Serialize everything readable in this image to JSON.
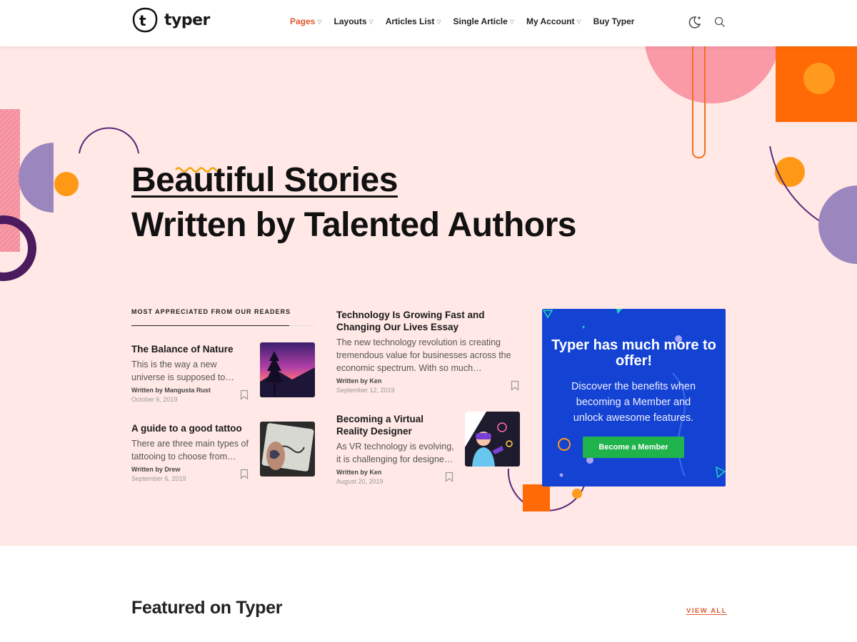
{
  "header": {
    "logo_text": "typer",
    "nav": [
      {
        "label": "Pages",
        "active": true,
        "chevron": true
      },
      {
        "label": "Layouts",
        "active": false,
        "chevron": true
      },
      {
        "label": "Articles List",
        "active": false,
        "chevron": true
      },
      {
        "label": "Single Article",
        "active": false,
        "chevron": true
      },
      {
        "label": "My Account",
        "active": false,
        "chevron": true
      },
      {
        "label": "Buy Typer",
        "active": false,
        "chevron": false
      }
    ],
    "icons": [
      "dark-mode-toggle-icon",
      "search-icon"
    ]
  },
  "hero": {
    "headline_line1": "Beautiful Stories",
    "headline_line2": "Written by Talented Authors"
  },
  "section_label": "MOST APPRECIATED FROM OUR READERS",
  "articles": [
    {
      "title": "The Balance of Nature",
      "excerpt": "This is the way a new universe is supposed to…",
      "author": "Written by Mangusta Rust",
      "date": "October 6, 2019"
    },
    {
      "title": "A guide to a good tattoo",
      "excerpt": "There are three main types of tattooing to choose from…",
      "author": "Written by Drew",
      "date": "September 6, 2019"
    },
    {
      "title": "Technology Is Growing Fast and Changing Our Lives Essay",
      "excerpt": "The new technology revolution is creating tremendous value for businesses across the economic spectrum. With so much…",
      "author": "Written by Ken",
      "date": "September 12, 2019"
    },
    {
      "title": "Becoming a Virtual Reality Designer",
      "excerpt": "As VR technology is evolving, it is challenging for designe…",
      "author": "Written by Ken",
      "date": "August 20, 2019"
    }
  ],
  "promo": {
    "title": "Typer has much more to offer!",
    "text": "Discover the benefits when becoming a Member and unlock awesome features.",
    "button": "Become a Member"
  },
  "featured": {
    "title": "Featured on Typer",
    "view_all": "VIEW ALL"
  },
  "colors": {
    "accent": "#e0592f",
    "hero_bg": "#ffe8e5",
    "promo_bg": "#1443d3",
    "button_green": "#20b34c"
  }
}
